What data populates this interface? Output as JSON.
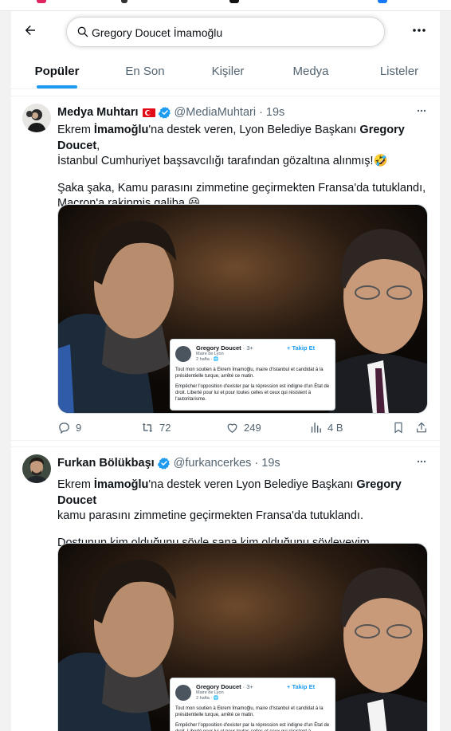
{
  "colors": {
    "accent": "#1d9bf0",
    "text": "#0f1419",
    "muted": "#536471"
  },
  "search": {
    "query": "Gregory Doucet İmamoğlu"
  },
  "tabs": [
    {
      "label": "Popüler",
      "active": true
    },
    {
      "label": "En Son"
    },
    {
      "label": "Kişiler"
    },
    {
      "label": "Medya"
    },
    {
      "label": "Listeler"
    }
  ],
  "tweets": [
    {
      "display_name": "Medya Muhtarı",
      "handle": "@MediaMuhtari",
      "time": "19s",
      "body": {
        "l1a": "Ekrem ",
        "l1b": "İmamoğlu",
        "l1c": "'na destek veren, Lyon Belediye Başkanı ",
        "l1d": "Gregory Doucet",
        "l1e": ",",
        "l2": "İstanbul Cumhuriyet başsavcılığı tarafından gözaltına alınmış!🤣",
        "l3": "Şaka şaka, Kamu parasını zimmetine geçirmekten Fransa'da tutuklandı,",
        "l4": "Macron'a rakipmiş galiba 😃"
      },
      "card": {
        "name": "Gregory Doucet",
        "badge": "· 3+",
        "sub1": "Maire de Lyon",
        "sub2": "2 hafta · 🌐",
        "follow": "+ Takip Et",
        "p1": "Tout mon soutien à Ekrem İmamoğlu, maire d'Istanbul et candidat à la présidentielle turque, arrêté ce matin.",
        "p2": "Empêcher l'opposition d'exister par la répression est indigne d'un État de droit. Liberté pour lui et pour toutes celles et ceux qui résistent à l'autoritarisme."
      },
      "stats": {
        "replies": "9",
        "retweets": "72",
        "likes": "249",
        "views": "4 B"
      }
    },
    {
      "display_name": "Furkan Bölükbaşı",
      "handle": "@furkancerkes",
      "time": "19s",
      "body": {
        "l1a": "Ekrem ",
        "l1b": "İmamoğlu",
        "l1c": "'na destek veren Lyon Belediye Başkanı ",
        "l1d": "Gregory Doucet",
        "l2": "kamu parasını zimmetine geçirmekten Fransa'da tutuklandı.",
        "l3": "Dostunun kim olduğunu söyle sana kim olduğunu söyleyeyim."
      },
      "card": {
        "name": "Gregory Doucet",
        "badge": "· 3+",
        "sub1": "Maire de Lyon",
        "sub2": "2 hafta · 🌐",
        "follow": "+ Takip Et",
        "p1": "Tout mon soutien à Ekrem İmamoğlu, maire d'Istanbul et candidat à la présidentielle turque, arrêté ce matin.",
        "p2": "Empêcher l'opposition d'exister par la répression est indigne d'un État de droit. Liberté pour lui et pour toutes celles et ceux qui résistent à l'autoritarisme."
      }
    }
  ]
}
